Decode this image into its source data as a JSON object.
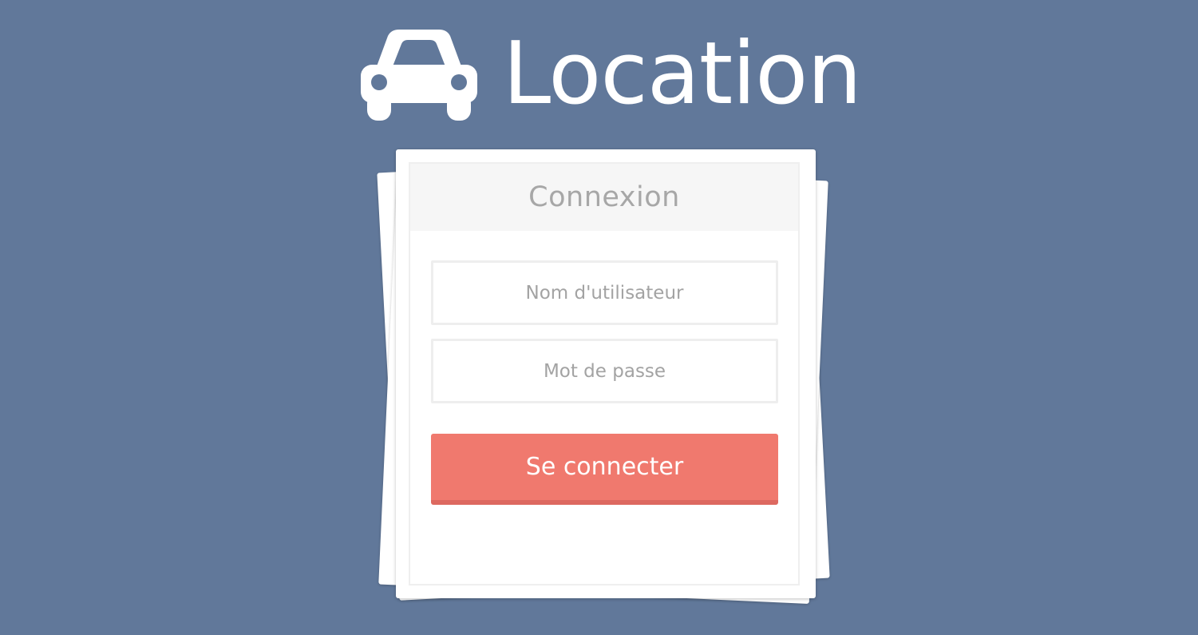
{
  "colors": {
    "background": "#61789a",
    "button": "#f0796e",
    "button_shadow": "#dd6960",
    "header_band": "#f6f6f6",
    "title_text": "#a7a7a7",
    "placeholder_text": "#a3a3a3"
  },
  "brand": {
    "icon": "car-icon",
    "title": "Location"
  },
  "login_card": {
    "title": "Connexion",
    "username": {
      "placeholder": "Nom d'utilisateur",
      "value": ""
    },
    "password": {
      "placeholder": "Mot de passe",
      "value": ""
    },
    "submit_label": "Se connecter"
  }
}
